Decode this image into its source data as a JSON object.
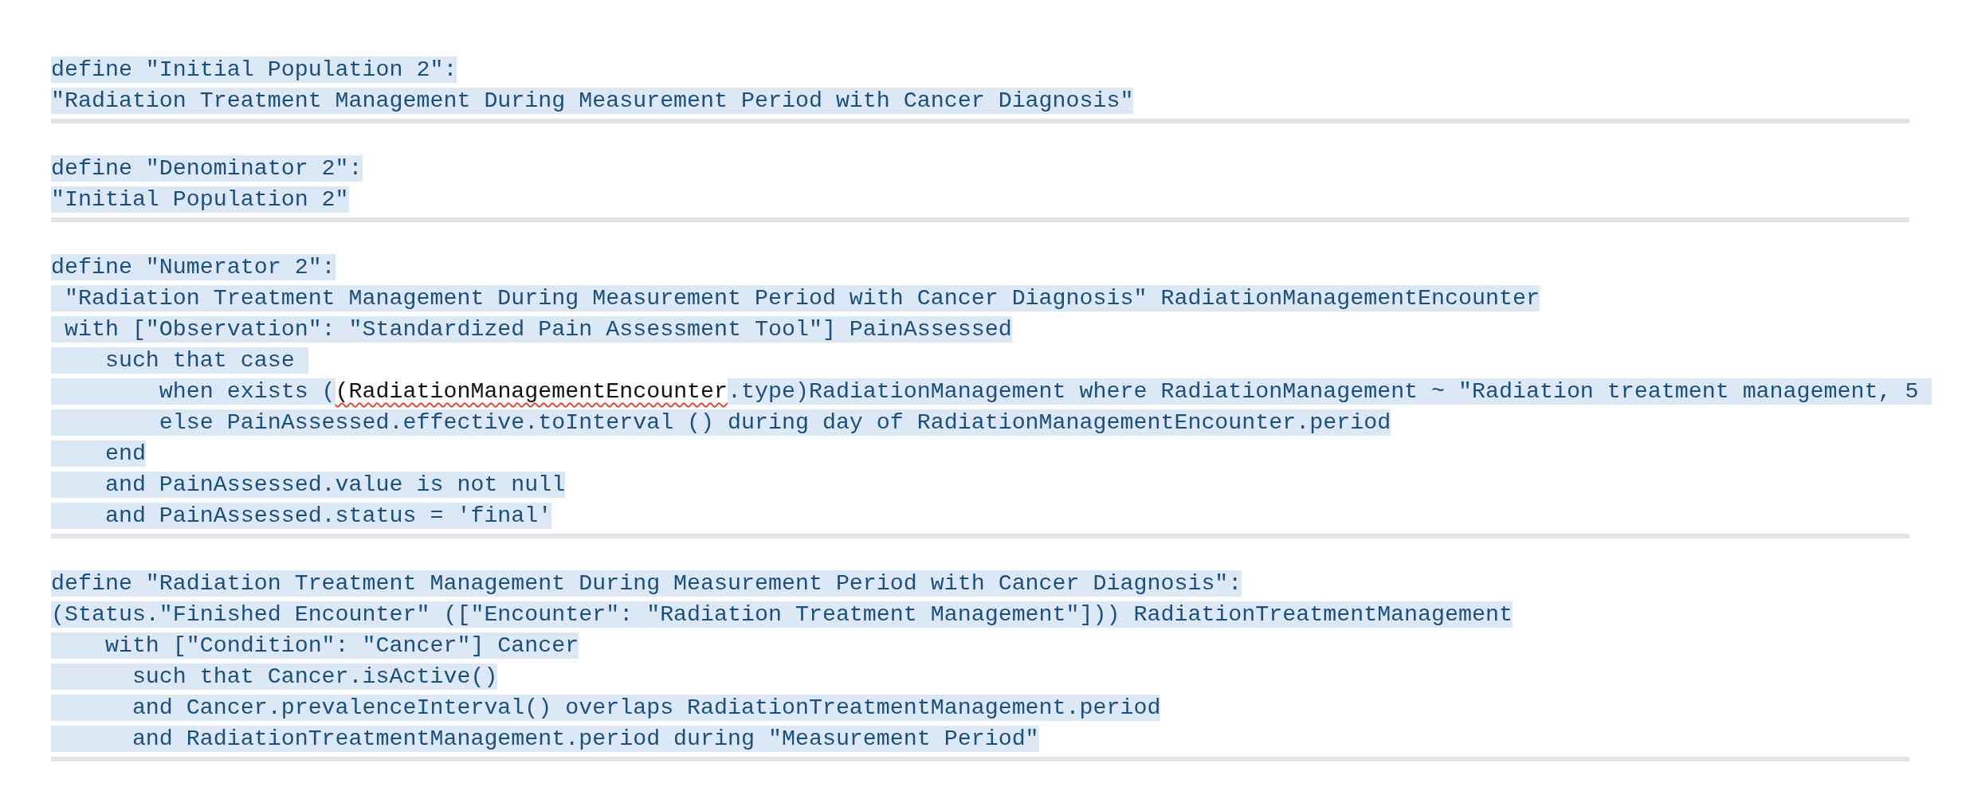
{
  "blocks": [
    {
      "lines": [
        {
          "text": "define \"Initial Population 2\":"
        },
        {
          "text": "\"Radiation Treatment Management During Measurement Period with Cancer Diagnosis\""
        }
      ]
    },
    {
      "lines": [
        {
          "text": "define \"Denominator 2\":"
        },
        {
          "text": "\"Initial Population 2\""
        }
      ]
    },
    {
      "lines": [
        {
          "text": "define \"Numerator 2\":"
        },
        {
          "text": " \"Radiation Treatment Management During Measurement Period with Cancer Diagnosis\" RadiationManagementEncounter"
        },
        {
          "text": " with [\"Observation\": \"Standardized Pain Assessment Tool\"] PainAssessed"
        },
        {
          "text": "    such that case "
        },
        {
          "parts": [
            {
              "text": "        when exists (",
              "flagged": false
            },
            {
              "text": "(RadiationManagementEncounter",
              "flagged": true
            },
            {
              "text": ".type)RadiationManagement where RadiationManagement ~ \"Radiation treatment management, 5 ",
              "flagged": false
            }
          ]
        },
        {
          "text": "        else PainAssessed.effective.toInterval () during day of RadiationManagementEncounter.period"
        },
        {
          "text": "    end"
        },
        {
          "text": "    and PainAssessed.value is not null"
        },
        {
          "text": "    and PainAssessed.status = 'final'"
        }
      ]
    },
    {
      "lines": [
        {
          "text": "define \"Radiation Treatment Management During Measurement Period with Cancer Diagnosis\":"
        },
        {
          "text": "(Status.\"Finished Encounter\" ([\"Encounter\": \"Radiation Treatment Management\"])) RadiationTreatmentManagement"
        },
        {
          "text": "    with [\"Condition\": \"Cancer\"] Cancer"
        },
        {
          "text": "      such that Cancer.isActive()"
        },
        {
          "text": "      and Cancer.prevalenceInterval() overlaps RadiationTreatmentManagement.period"
        },
        {
          "text": "      and RadiationTreatmentManagement.period during \"Measurement Period\""
        }
      ]
    }
  ]
}
